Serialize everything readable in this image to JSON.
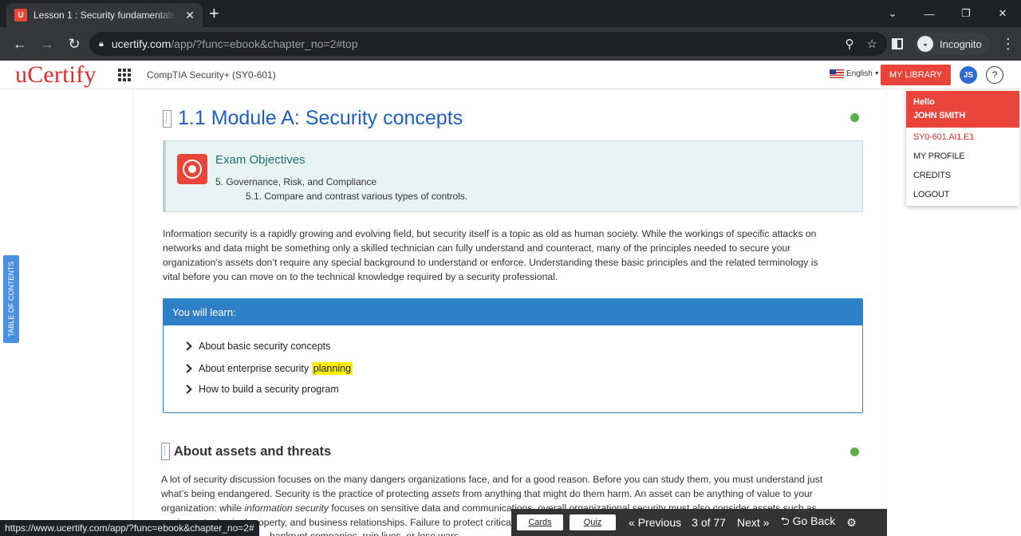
{
  "browser": {
    "tab_title": "Lesson 1 : Security fundamentals",
    "favicon_text": "U",
    "url_host": "ucertify.com",
    "url_path": "/app/?func=ebook&chapter_no=2#top",
    "incognito_label": "Incognito",
    "status_url": "https://www.ucertify.com/app/?func=ebook&chapter_no=2#"
  },
  "header": {
    "logo": "uCertify",
    "course_title": "CompTIA Security+ (SY0-601)",
    "language": "English",
    "my_library": "MY LIBRARY",
    "avatar_initials": "JS",
    "help": "?"
  },
  "user_menu": {
    "hello": "Hello",
    "name": "JOHN SMITH",
    "code": "SY0-601.AI1.E1",
    "items": [
      "MY PROFILE",
      "CREDITS",
      "LOGOUT"
    ]
  },
  "toc_label": "TABLE OF CONTENTS",
  "main": {
    "title": "1.1 Module A: Security concepts",
    "objectives": {
      "title": "Exam Objectives",
      "line1": "5. Governance, Risk, and Compliance",
      "line2": "5.1. Compare and contrast various types of controls."
    },
    "intro": [
      "Information security is a rapidly growing and evolving field, but security itself is a topic as old as human society. While the workings of specific attacks on",
      "networks and data might be something only a skilled technician can fully understand and counteract, many of the principles needed to secure your",
      "organization’s assets don’t require any special background to understand or enforce. Understanding these basic principles and the related terminology is",
      "vital before you can move on to the technical knowledge required by a security professional."
    ],
    "learn_heading": "You will learn:",
    "learn_items": [
      "About basic security concepts",
      "About enterprise security",
      "How to build a security program"
    ],
    "learn_highlight": "planning",
    "section2_title": "About assets and threats",
    "section2": {
      "line1": "A lot of security discussion focuses on the many dangers organizations face, and for a good reason. Before you can study them, you must understand just",
      "line2_a": "what’s being endangered. Security is the practice of protecting ",
      "line2_em": "assets",
      "line2_b": " from anything that might do them harm. An asset can be anything of value to your",
      "line3_a": "organization: while ",
      "line3_em": "information security",
      "line3_b": " focuses on sensitive data and communications, overall organizational security must also consider assets such as",
      "line4": "equipment, physical property, and business relationships. Failure to protect critical assets can",
      "line5": "bankrupt companies, ruin lives, or lose wars."
    }
  },
  "bottom_bar": {
    "cards": "Cards",
    "quiz": "Quiz",
    "previous": "Previous",
    "page": "3 of 77",
    "next": "Next",
    "go_back": "Go Back"
  },
  "colors": {
    "brand_red": "#e8443a",
    "primary_blue": "#2f7fc8",
    "status_green": "#5cad4a"
  }
}
